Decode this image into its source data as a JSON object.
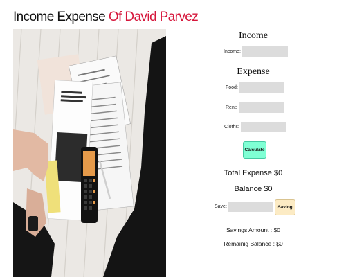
{
  "title": {
    "main": "Income Expense ",
    "highlight": "Of David Parvez"
  },
  "income": {
    "heading": "Income",
    "label": "Income:",
    "value": ""
  },
  "expense": {
    "heading": "Expense",
    "food_label": "Food:",
    "food_value": "",
    "rent_label": "Rent:",
    "rent_value": "",
    "cloths_label": "Cloths:",
    "cloths_value": ""
  },
  "calculate_label": "Calculate",
  "total_expense": "Total Expense $0",
  "balance": "Balance $0",
  "save": {
    "label": "Save:",
    "value": "",
    "percent_sign": "%",
    "button_label": "Saving"
  },
  "savings_amount": "Savings Amount : $0",
  "remaining_balance": "Remainig Balance : $0",
  "colors": {
    "highlight": "#d6163b",
    "calculate_button": "#7fffd4",
    "saving_button": "#fcebc4",
    "input_bg": "#dcdcdc"
  }
}
